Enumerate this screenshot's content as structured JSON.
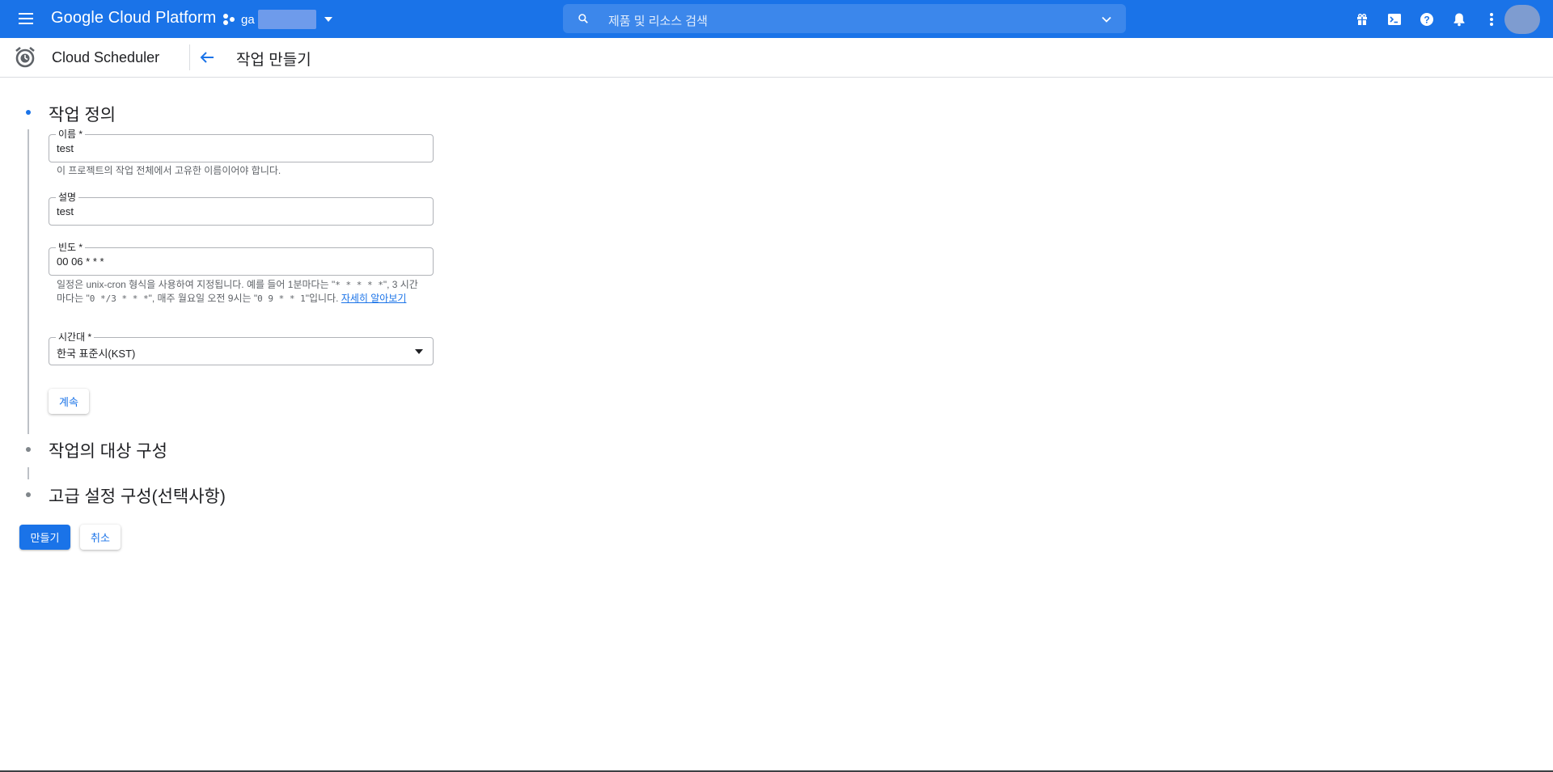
{
  "topbar": {
    "brand": "Google Cloud Platform",
    "project_name": "ga",
    "search_placeholder": "제품 및 리소스 검색",
    "icons": [
      "menu-icon",
      "project-icon",
      "search-icon",
      "chevron-down-icon",
      "gift-icon",
      "cloud-shell-icon",
      "help-icon",
      "notifications-icon",
      "more-vert-icon",
      "avatar"
    ],
    "accent_color": "#1a73e8"
  },
  "subheader": {
    "product": "Cloud Scheduler",
    "page_title": "작업 만들기"
  },
  "steps": [
    {
      "title": "작업 정의",
      "active": true
    },
    {
      "title": "작업의 대상 구성",
      "active": false
    },
    {
      "title": "고급 설정 구성(선택사항)",
      "active": false
    }
  ],
  "form": {
    "name": {
      "label": "이름 *",
      "value": "test",
      "hint": "이 프로젝트의 작업 전체에서 고유한 이름이어야 합니다."
    },
    "description": {
      "label": "설명",
      "value": "test"
    },
    "frequency": {
      "label": "빈도 *",
      "value": "00 06 * * *",
      "hint_part1": "일정은 unix-cron 형식을 사용하여 지정됩니다. 예를 들어 1분마다는 \"",
      "hint_code1": "* * * * *",
      "hint_part2": "\", 3 시간마다는 \"",
      "hint_code2": "0 */3 * * *",
      "hint_part3": "\", 매주 월요일 오전 9시는 \"",
      "hint_code3": "0 9 * * 1",
      "hint_part4": "\"입니다. ",
      "hint_link": "자세히 알아보기"
    },
    "timezone": {
      "label": "시간대 *",
      "value": "한국 표준시(KST)"
    },
    "continue_label": "계속"
  },
  "actions": {
    "create_label": "만들기",
    "cancel_label": "취소"
  }
}
